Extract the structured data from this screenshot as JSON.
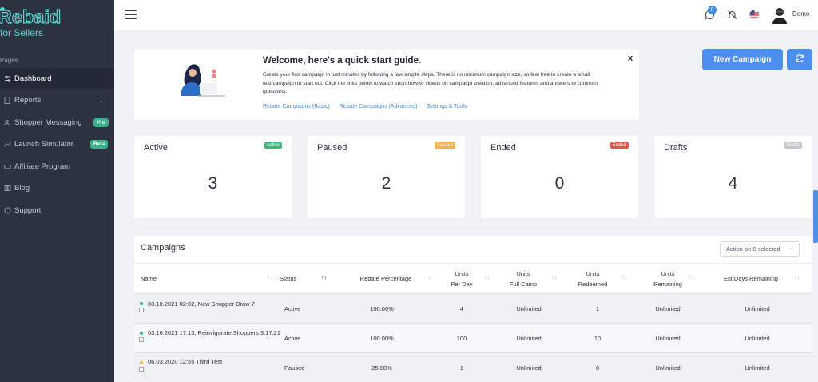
{
  "brand": {
    "name": "Rebaid",
    "tagline": "for Sellers"
  },
  "sidebar": {
    "section": "Pages",
    "items": [
      {
        "label": "Dashboard",
        "icon": "sliders-icon"
      },
      {
        "label": "Reports",
        "icon": "file-icon"
      },
      {
        "label": "Shopper Messaging",
        "icon": "users-icon",
        "badge": "Pro"
      },
      {
        "label": "Launch Simulator",
        "icon": "trend-icon",
        "badge": "Beta"
      },
      {
        "label": "Affiliate Program",
        "icon": "link-icon"
      },
      {
        "label": "Blog",
        "icon": "book-icon"
      },
      {
        "label": "Support",
        "icon": "help-icon"
      }
    ]
  },
  "topbar": {
    "notification_count": "0",
    "user_name": "Demo"
  },
  "welcome": {
    "title": "Welcome, here's a quick start guide.",
    "text": "Create your first campaign in just minutes by following a few simple steps. There is no minimum campaign size, so feel free to create a small test campaign to start out. Click the links below to watch short how-to videos on campaign creation, advanced features and answers to common questions.",
    "links": [
      "Rebate Campaigns (Basic)",
      "Rebate Campaigns (Advanced)",
      "Settings & Tools"
    ],
    "close": "x"
  },
  "actions": {
    "new_campaign": "New Campaign"
  },
  "stats": [
    {
      "title": "Active",
      "badge": "Active",
      "value": "3",
      "color": "#3bb77e"
    },
    {
      "title": "Paused",
      "badge": "Paused",
      "value": "2",
      "color": "#f1b24a"
    },
    {
      "title": "Ended",
      "badge": "Ended",
      "value": "0",
      "color": "#e0554d"
    },
    {
      "title": "Drafts",
      "badge": "Drafts",
      "value": "4",
      "color": "#c4c7cc"
    }
  ],
  "campaigns": {
    "title": "Campaigns",
    "action_select": "Action on 0 selected",
    "headers": [
      "Name",
      "Status",
      "Rebate Percentage",
      "Units Per Day",
      "Units Full Camp",
      "Units Redeemed",
      "Units Remaining",
      "Est Days Remaining"
    ],
    "rows": [
      {
        "name": "03.10.2021 02:02, New Shopper Draw 7",
        "status": "Active",
        "rebate": "100.00%",
        "per_day": "4",
        "full_camp": "Unlimited",
        "redeemed": "1",
        "remaining": "Unlimited",
        "est_days": "Unlimited",
        "dot": "#3bb77e"
      },
      {
        "name": "03.16.2021 17:13, Reinvigorate Shoppers 3.17.21",
        "status": "Active",
        "rebate": "100.00%",
        "per_day": "100",
        "full_camp": "Unlimited",
        "redeemed": "10",
        "remaining": "Unlimited",
        "est_days": "Unlimited",
        "dot": "#3bb77e"
      },
      {
        "name": "06.03.2020 12:55 Third Test",
        "status": "Paused",
        "rebate": "25.00%",
        "per_day": "1",
        "full_camp": "Unlimited",
        "redeemed": "0",
        "remaining": "Unlimited",
        "est_days": "Unlimited",
        "dot": "#f1b24a"
      }
    ]
  }
}
